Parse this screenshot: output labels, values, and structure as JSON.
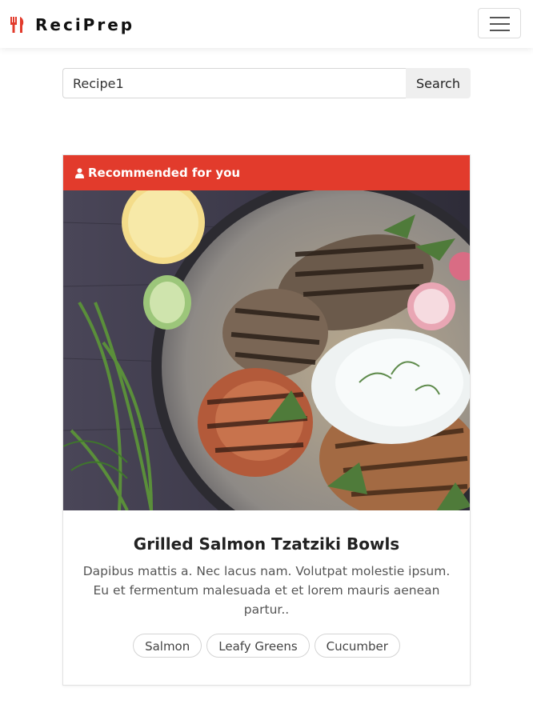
{
  "brand": {
    "name": "ReciPrep",
    "icon": "fork-knife-icon",
    "icon_color": "#e23b2c"
  },
  "navbar": {
    "toggle_icon": "hamburger-menu-icon"
  },
  "search": {
    "value": "Recipe1",
    "button_label": "Search"
  },
  "card": {
    "header": {
      "icon": "user-icon",
      "label": "Recommended for you",
      "color": "#e23b2c"
    },
    "image_alt": "Grilled salmon tzatziki bowl",
    "title": "Grilled Salmon Tzatziki Bowls",
    "description": "Dapibus mattis a. Nec lacus nam. Volutpat molestie ipsum. Eu et fermentum malesuada et et lorem mauris aenean partur..",
    "tags": [
      "Salmon",
      "Leafy Greens",
      "Cucumber"
    ]
  }
}
